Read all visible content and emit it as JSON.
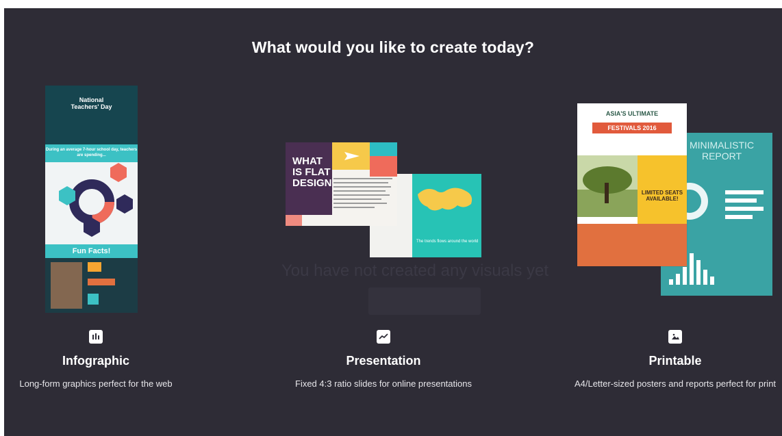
{
  "modal": {
    "title": "What would you like to create today?",
    "background_hint": {
      "empty_message": "You have not created any visuals yet"
    }
  },
  "options": [
    {
      "name": "Infographic",
      "description": "Long-form graphics perfect for the web",
      "icon": "bar-chart-icon",
      "thumbnail": {
        "heading": "National Teachers' Day",
        "subheading": "During an average 7-hour school day, teachers are spending...",
        "footer": "Fun Facts!"
      }
    },
    {
      "name": "Presentation",
      "description": "Fixed 4:3 ratio slides for online presentations",
      "icon": "line-chart-icon",
      "thumbnail": {
        "slide_title": "WHAT IS FLAT DESIGN",
        "caption": "The trends flows around the world"
      }
    },
    {
      "name": "Printable",
      "description": "A4/Letter-sized posters and reports perfect for print",
      "icon": "image-icon",
      "thumbnail": {
        "poster_heading": "ASIA'S ULTIMATE",
        "poster_banner": "FESTIVALS 2016",
        "poster_offer": "LIMITED SEATS AVAILABLE!",
        "report_title": "MINIMALISTIC REPORT"
      }
    }
  ],
  "colors": {
    "modal_bg": "#2e2c36",
    "text_primary": "#ffffff",
    "accent_teal": "#3cc1c4",
    "accent_coral": "#e15a3c"
  }
}
